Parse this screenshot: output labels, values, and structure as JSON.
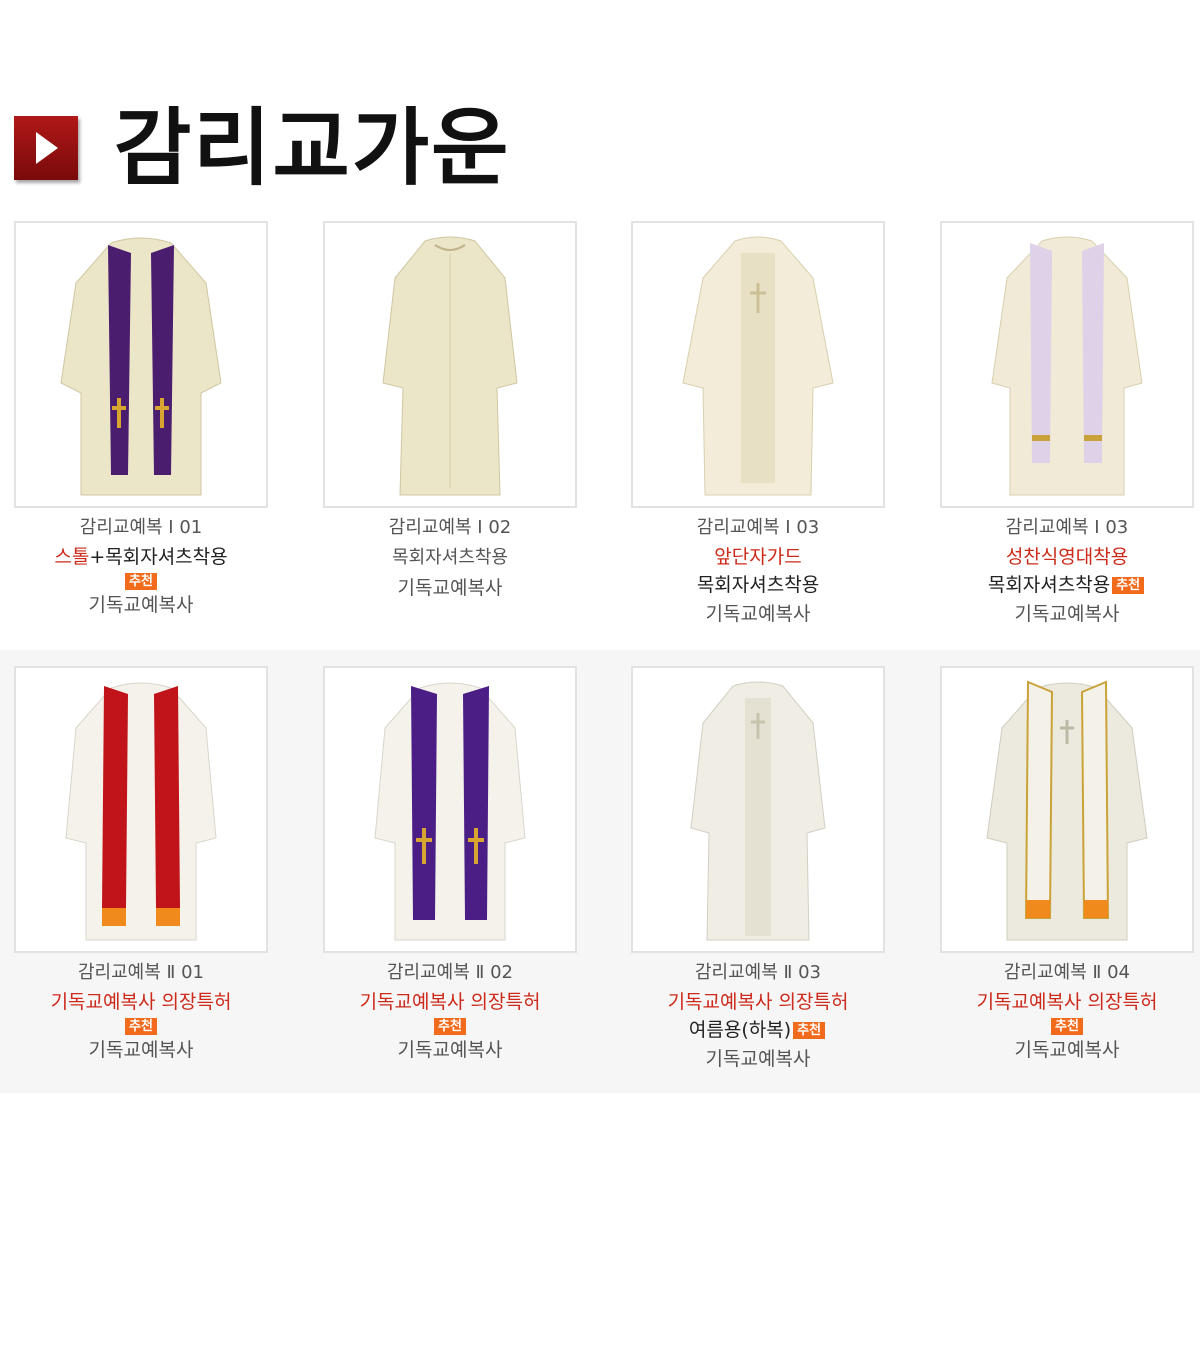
{
  "page": {
    "title": "감리교가운",
    "title_icon": "play-arrow-icon"
  },
  "colors": {
    "accent_red": "#cc2a1a",
    "badge_orange": "#f26a1b",
    "icon_red": "#9a1010"
  },
  "products": [
    {
      "model": "감리교예복 Ⅰ 01",
      "line_a_red": "스톨",
      "line_a_dark": "+목회자셔츠착용",
      "badge": "추천",
      "brand": "기독교예복사"
    },
    {
      "model": "감리교예복 Ⅰ 02",
      "line_b": "목회자셔츠착용",
      "brand": "기독교예복사"
    },
    {
      "model": "감리교예복 Ⅰ 03",
      "line_red": "앞단자가드",
      "line_dark": "목회자셔츠착용",
      "brand": "기독교예복사"
    },
    {
      "model": "감리교예복 Ⅰ 03",
      "line_red": "성찬식영대착용",
      "line_dark": "목회자셔츠착용",
      "badge": "추천",
      "brand": "기독교예복사"
    },
    {
      "model": "감리교예복 Ⅱ 01",
      "line_red": "기독교예복사 의장특허",
      "badge": "추천",
      "brand": "기독교예복사"
    },
    {
      "model": "감리교예복 Ⅱ 02",
      "line_red": "기독교예복사 의장특허",
      "badge": "추천",
      "brand": "기독교예복사"
    },
    {
      "model": "감리교예복 Ⅱ 03",
      "line_red": "기독교예복사 의장특허",
      "line_dark": "여름용(하복)",
      "badge": "추천",
      "brand": "기독교예복사"
    },
    {
      "model": "감리교예복 Ⅱ 04",
      "line_red": "기독교예복사 의장특허",
      "badge": "추천",
      "brand": "기독교예복사"
    }
  ]
}
